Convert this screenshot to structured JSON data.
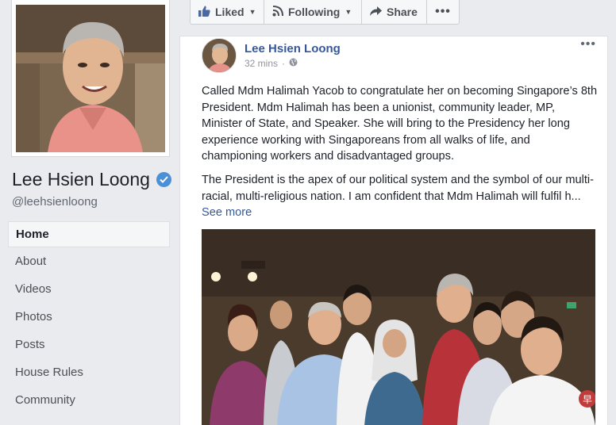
{
  "page": {
    "name": "Lee Hsien Loong",
    "handle": "@leehsienloong"
  },
  "nav": {
    "items": [
      "Home",
      "About",
      "Videos",
      "Photos",
      "Posts",
      "House Rules",
      "Community"
    ],
    "active": "Home"
  },
  "actions": {
    "liked": "Liked",
    "following": "Following",
    "share": "Share"
  },
  "post": {
    "author": "Lee Hsien Loong",
    "time": "32 mins",
    "paragraph1": "Called Mdm Halimah Yacob to congratulate her on becoming Singapore’s 8th President. Mdm Halimah has been a unionist, community leader, MP, Minister of State, and Speaker. She will bring to the Presidency her long experience working with Singaporeans from all walks of life, and championing workers and disadvantaged groups.",
    "paragraph2": "The President is the apex of our political system and the symbol of our multi-racial, multi-religious nation. I am confident that Mdm Halimah will fulfil h...",
    "see_more": "See more"
  },
  "colors": {
    "link_blue": "#365899",
    "verified_blue": "#4a90d9",
    "background": "#e9ebee"
  },
  "icons": [
    "like-icon",
    "rss-icon",
    "share-icon",
    "globe-icon",
    "verified-icon",
    "more-icon"
  ]
}
